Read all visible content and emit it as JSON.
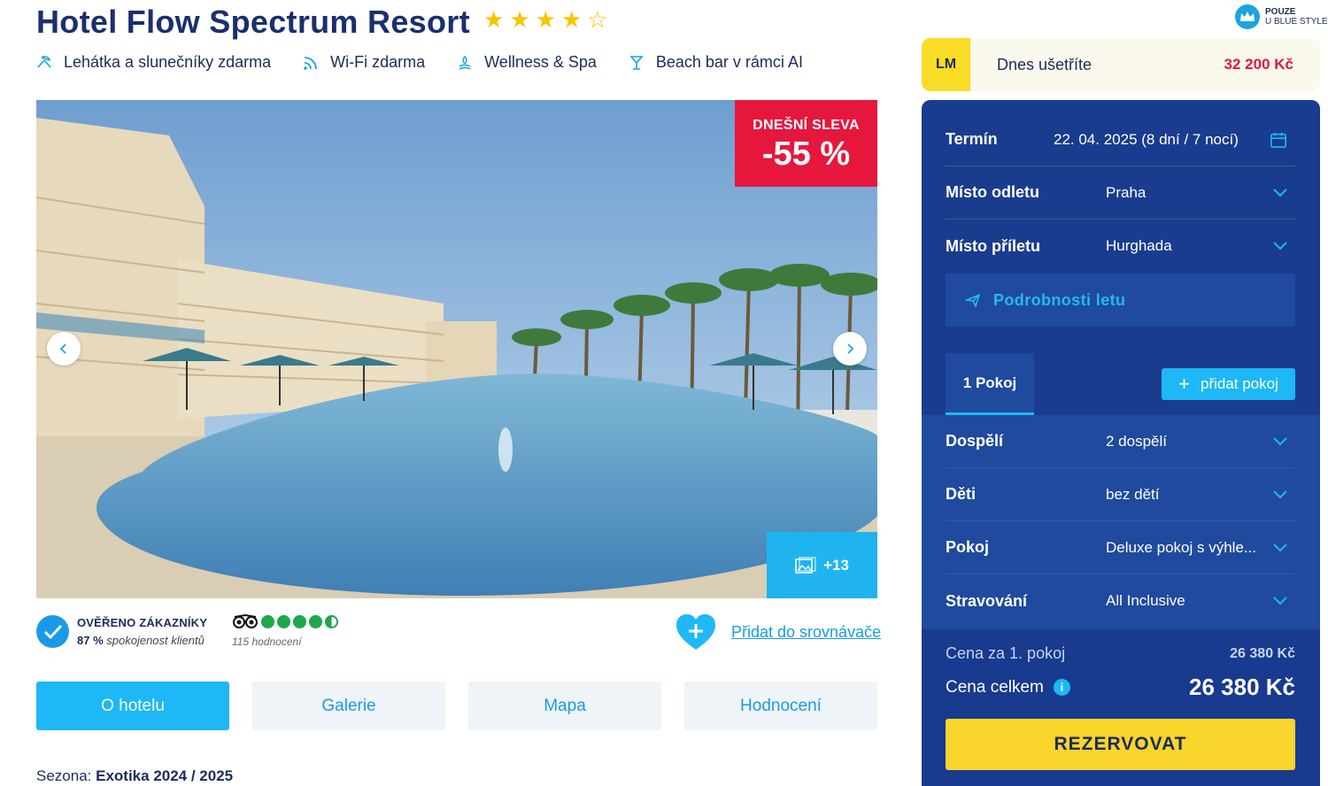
{
  "hotel": {
    "name": "Hotel Flow Spectrum Resort",
    "stars_rating": 4,
    "stars_max": 5
  },
  "amenities": [
    {
      "icon": "sunbed-icon",
      "label": "Lehátka a slunečníky zdarma"
    },
    {
      "icon": "wifi-icon",
      "label": "Wi-Fi zdarma"
    },
    {
      "icon": "spa-icon",
      "label": "Wellness & Spa"
    },
    {
      "icon": "cocktail-icon",
      "label": "Beach bar v rámci AI"
    }
  ],
  "hero": {
    "discount_label": "DNEŠNÍ SLEVA",
    "discount_value": "-55 %",
    "photo_count": "+13"
  },
  "verification": {
    "title": "OVĚŘENO ZÁKAZNÍKY",
    "percent": "87 %",
    "percent_text": "spokojenost klientů"
  },
  "tripadvisor": {
    "rating": 4.5,
    "reviews": "115 hodnocení"
  },
  "compare": {
    "label": "Přidat do srovnávače"
  },
  "tabs": [
    {
      "label": "O hotelu",
      "active": true
    },
    {
      "label": "Galerie",
      "active": false
    },
    {
      "label": "Mapa",
      "active": false
    },
    {
      "label": "Hodnocení",
      "active": false
    }
  ],
  "season": {
    "label": "Sezona:",
    "value": "Exotika 2024 / 2025"
  },
  "badge": {
    "line1": "POUZE",
    "line2": "U BLUE STYLE"
  },
  "lm": {
    "tag": "LM",
    "text": "Dnes ušetříte",
    "amount": "32 200 Kč"
  },
  "booking": {
    "term_label": "Termín",
    "term_value": "22. 04. 2025 (8 dní / 7 nocí)",
    "departure_label": "Místo odletu",
    "departure_value": "Praha",
    "arrival_label": "Místo příletu",
    "arrival_value": "Hurghada",
    "flight_details": "Podrobnosti letu",
    "room_tab": "1 Pokoj",
    "add_room": "přidat pokoj",
    "adults_label": "Dospělí",
    "adults_value": "2 dospělí",
    "children_label": "Děti",
    "children_value": "bez dětí",
    "room_label": "Pokoj",
    "room_value": "Deluxe pokoj s výhle...",
    "meal_label": "Stravování",
    "meal_value": "All Inclusive",
    "price_room_label": "Cena za 1. pokoj",
    "price_room_value": "26 380 Kč",
    "price_total_label": "Cena celkem",
    "price_total_value": "26 380 Kč",
    "reserve": "REZERVOVAT"
  },
  "colors": {
    "brand_navy": "#1a3c8f",
    "accent_cyan": "#1db8f5",
    "discount_red": "#e6173d",
    "cta_yellow": "#fad52c",
    "star_yellow": "#f7c500",
    "tripadvisor_green": "#1fa64a"
  }
}
